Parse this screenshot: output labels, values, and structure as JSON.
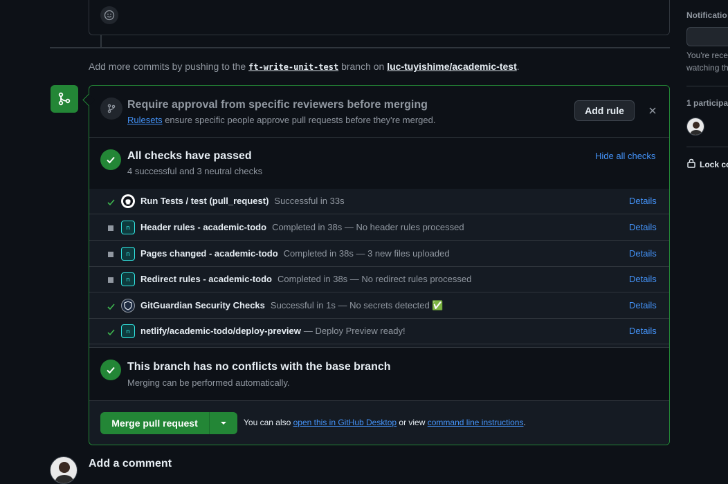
{
  "push_note": {
    "prefix": "Add more commits by pushing to the",
    "branch": "ft-write-unit-test",
    "middle": "branch on",
    "repo": "luc-tuyishime/academic-test",
    "suffix": "."
  },
  "ruleset": {
    "title": "Require approval from specific reviewers before merging",
    "link": "Rulesets",
    "description": "ensure specific people approve pull requests before they're merged.",
    "add_rule": "Add rule"
  },
  "checks": {
    "title": "All checks have passed",
    "summary": "4 successful and 3 neutral checks",
    "hide_all": "Hide all checks",
    "items": [
      {
        "status": "success",
        "name": "Run Tests / test (pull_request)",
        "desc": "Successful in 33s",
        "details": "Details"
      },
      {
        "status": "neutral",
        "name": "Header rules - academic-todo",
        "desc": "Completed in 38s — No header rules processed",
        "details": "Details"
      },
      {
        "status": "neutral",
        "name": "Pages changed - academic-todo",
        "desc": "Completed in 38s — 3 new files uploaded",
        "details": "Details"
      },
      {
        "status": "neutral",
        "name": "Redirect rules - academic-todo",
        "desc": "Completed in 38s — No redirect rules processed",
        "details": "Details"
      },
      {
        "status": "success",
        "name": "GitGuardian Security Checks",
        "desc": "Successful in 1s — No secrets detected ✅",
        "details": "Details"
      },
      {
        "status": "success",
        "name": "netlify/academic-todo/deploy-preview",
        "desc": "— Deploy Preview ready!",
        "details": "Details"
      }
    ]
  },
  "conflicts": {
    "title": "This branch has no conflicts with the base branch",
    "subtitle": "Merging can be performed automatically."
  },
  "merge": {
    "button": "Merge pull request",
    "note_prefix": "You can also",
    "desktop_link": "open this in GitHub Desktop",
    "note_middle": "or view",
    "cli_link": "command line instructions",
    "note_suffix": "."
  },
  "comment": {
    "heading": "Add a comment"
  },
  "sidebar": {
    "notifications_label": "Notificatio",
    "notif_text_1": "You're rece",
    "notif_text_2": "watching th",
    "participants_label": "1 participa",
    "lock_label": "Lock co"
  },
  "colors": {
    "success": "#238636",
    "link": "#4493f8",
    "background": "#0d1117"
  }
}
